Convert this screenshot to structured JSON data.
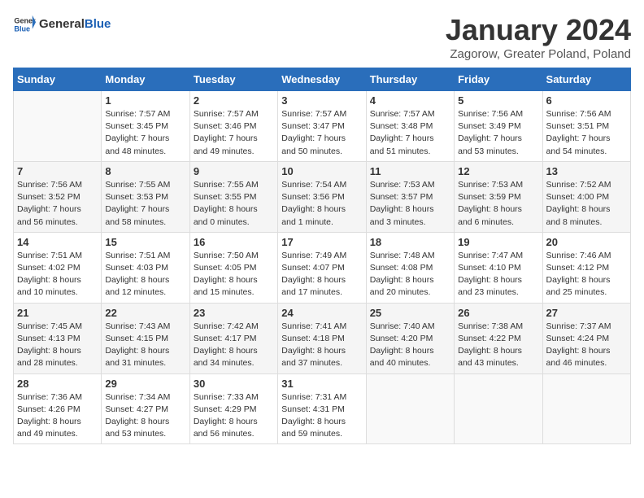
{
  "logo": {
    "text_general": "General",
    "text_blue": "Blue"
  },
  "title": "January 2024",
  "subtitle": "Zagorow, Greater Poland, Poland",
  "days_header": [
    "Sunday",
    "Monday",
    "Tuesday",
    "Wednesday",
    "Thursday",
    "Friday",
    "Saturday"
  ],
  "weeks": [
    [
      {
        "num": "",
        "info": ""
      },
      {
        "num": "1",
        "info": "Sunrise: 7:57 AM\nSunset: 3:45 PM\nDaylight: 7 hours\nand 48 minutes."
      },
      {
        "num": "2",
        "info": "Sunrise: 7:57 AM\nSunset: 3:46 PM\nDaylight: 7 hours\nand 49 minutes."
      },
      {
        "num": "3",
        "info": "Sunrise: 7:57 AM\nSunset: 3:47 PM\nDaylight: 7 hours\nand 50 minutes."
      },
      {
        "num": "4",
        "info": "Sunrise: 7:57 AM\nSunset: 3:48 PM\nDaylight: 7 hours\nand 51 minutes."
      },
      {
        "num": "5",
        "info": "Sunrise: 7:56 AM\nSunset: 3:49 PM\nDaylight: 7 hours\nand 53 minutes."
      },
      {
        "num": "6",
        "info": "Sunrise: 7:56 AM\nSunset: 3:51 PM\nDaylight: 7 hours\nand 54 minutes."
      }
    ],
    [
      {
        "num": "7",
        "info": "Sunrise: 7:56 AM\nSunset: 3:52 PM\nDaylight: 7 hours\nand 56 minutes."
      },
      {
        "num": "8",
        "info": "Sunrise: 7:55 AM\nSunset: 3:53 PM\nDaylight: 7 hours\nand 58 minutes."
      },
      {
        "num": "9",
        "info": "Sunrise: 7:55 AM\nSunset: 3:55 PM\nDaylight: 8 hours\nand 0 minutes."
      },
      {
        "num": "10",
        "info": "Sunrise: 7:54 AM\nSunset: 3:56 PM\nDaylight: 8 hours\nand 1 minute."
      },
      {
        "num": "11",
        "info": "Sunrise: 7:53 AM\nSunset: 3:57 PM\nDaylight: 8 hours\nand 3 minutes."
      },
      {
        "num": "12",
        "info": "Sunrise: 7:53 AM\nSunset: 3:59 PM\nDaylight: 8 hours\nand 6 minutes."
      },
      {
        "num": "13",
        "info": "Sunrise: 7:52 AM\nSunset: 4:00 PM\nDaylight: 8 hours\nand 8 minutes."
      }
    ],
    [
      {
        "num": "14",
        "info": "Sunrise: 7:51 AM\nSunset: 4:02 PM\nDaylight: 8 hours\nand 10 minutes."
      },
      {
        "num": "15",
        "info": "Sunrise: 7:51 AM\nSunset: 4:03 PM\nDaylight: 8 hours\nand 12 minutes."
      },
      {
        "num": "16",
        "info": "Sunrise: 7:50 AM\nSunset: 4:05 PM\nDaylight: 8 hours\nand 15 minutes."
      },
      {
        "num": "17",
        "info": "Sunrise: 7:49 AM\nSunset: 4:07 PM\nDaylight: 8 hours\nand 17 minutes."
      },
      {
        "num": "18",
        "info": "Sunrise: 7:48 AM\nSunset: 4:08 PM\nDaylight: 8 hours\nand 20 minutes."
      },
      {
        "num": "19",
        "info": "Sunrise: 7:47 AM\nSunset: 4:10 PM\nDaylight: 8 hours\nand 23 minutes."
      },
      {
        "num": "20",
        "info": "Sunrise: 7:46 AM\nSunset: 4:12 PM\nDaylight: 8 hours\nand 25 minutes."
      }
    ],
    [
      {
        "num": "21",
        "info": "Sunrise: 7:45 AM\nSunset: 4:13 PM\nDaylight: 8 hours\nand 28 minutes."
      },
      {
        "num": "22",
        "info": "Sunrise: 7:43 AM\nSunset: 4:15 PM\nDaylight: 8 hours\nand 31 minutes."
      },
      {
        "num": "23",
        "info": "Sunrise: 7:42 AM\nSunset: 4:17 PM\nDaylight: 8 hours\nand 34 minutes."
      },
      {
        "num": "24",
        "info": "Sunrise: 7:41 AM\nSunset: 4:18 PM\nDaylight: 8 hours\nand 37 minutes."
      },
      {
        "num": "25",
        "info": "Sunrise: 7:40 AM\nSunset: 4:20 PM\nDaylight: 8 hours\nand 40 minutes."
      },
      {
        "num": "26",
        "info": "Sunrise: 7:38 AM\nSunset: 4:22 PM\nDaylight: 8 hours\nand 43 minutes."
      },
      {
        "num": "27",
        "info": "Sunrise: 7:37 AM\nSunset: 4:24 PM\nDaylight: 8 hours\nand 46 minutes."
      }
    ],
    [
      {
        "num": "28",
        "info": "Sunrise: 7:36 AM\nSunset: 4:26 PM\nDaylight: 8 hours\nand 49 minutes."
      },
      {
        "num": "29",
        "info": "Sunrise: 7:34 AM\nSunset: 4:27 PM\nDaylight: 8 hours\nand 53 minutes."
      },
      {
        "num": "30",
        "info": "Sunrise: 7:33 AM\nSunset: 4:29 PM\nDaylight: 8 hours\nand 56 minutes."
      },
      {
        "num": "31",
        "info": "Sunrise: 7:31 AM\nSunset: 4:31 PM\nDaylight: 8 hours\nand 59 minutes."
      },
      {
        "num": "",
        "info": ""
      },
      {
        "num": "",
        "info": ""
      },
      {
        "num": "",
        "info": ""
      }
    ]
  ]
}
